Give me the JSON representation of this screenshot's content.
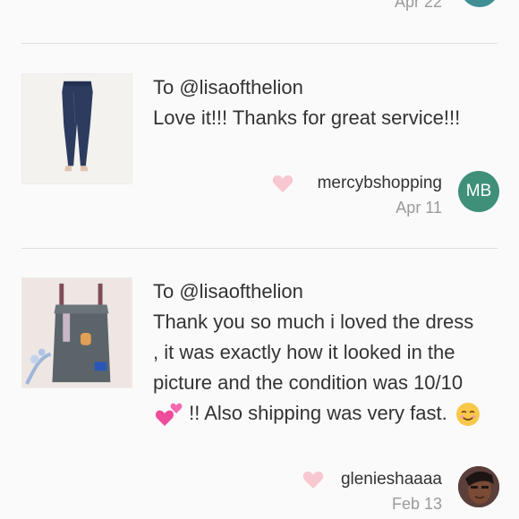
{
  "previous_item": {
    "date": "Apr 22",
    "avatar_color": "#3f8f95"
  },
  "reviews": [
    {
      "to": "To @lisaofthelion",
      "text": "Love it!!! Thanks for great service!!!",
      "username": "mercybshopping",
      "date": "Apr 11",
      "avatar": {
        "initials": "MB",
        "color": "#3f8f79"
      },
      "thumbnail_icon": "jeans-image",
      "heart_color": "#f7c8cf"
    },
    {
      "to": "To @lisaofthelion",
      "text_before_emoji": "Thank you so much i loved the dress , it was exactly how it looked in the picture and the condition was 10/10",
      "emoji_1": "two-hearts-icon",
      "text_middle": " !! Also shipping was very fast.",
      "emoji_2": "smiling-face-icon",
      "username": "glenieshaaaa",
      "date": "Feb 13",
      "avatar": {
        "type": "photo"
      },
      "thumbnail_icon": "denim-overall-dress-image",
      "heart_color": "#f7c8cf"
    }
  ]
}
